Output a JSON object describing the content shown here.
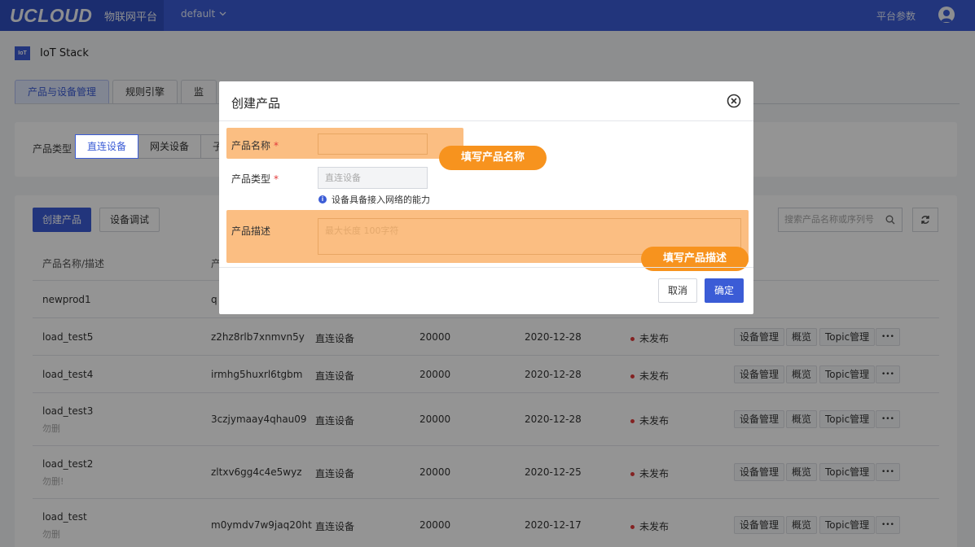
{
  "topbar": {
    "logo": "UCLOUD",
    "platform": "物联网平台",
    "project": "default",
    "platform_params": "平台参数"
  },
  "header": {
    "logo_text": "IoT",
    "title": "IoT Stack"
  },
  "tabs": [
    {
      "label": "产品与设备管理"
    },
    {
      "label": "规则引擎"
    },
    {
      "label": "监"
    }
  ],
  "filter": {
    "label": "产品类型",
    "options": [
      {
        "label": "直连设备"
      },
      {
        "label": "网关设备"
      },
      {
        "label": "子"
      }
    ]
  },
  "toolbar": {
    "create_label": "创建产品",
    "debug_label": "设备调试",
    "search_placeholder": "搜索产品名称或序列号"
  },
  "table": {
    "columns": [
      "产品名称/描述",
      "产"
    ],
    "rows": [
      {
        "name": "newprod1",
        "desc": "",
        "sn": "q",
        "type": "",
        "limit": "",
        "date": "",
        "status": ""
      },
      {
        "name": "load_test5",
        "desc": "",
        "sn": "z2hz8rlb7xnmvn5y",
        "type": "直连设备",
        "limit": "20000",
        "date": "2020-12-28",
        "status": "未发布"
      },
      {
        "name": "load_test4",
        "desc": "",
        "sn": "irmhg5huxrl6tgbm",
        "type": "直连设备",
        "limit": "20000",
        "date": "2020-12-28",
        "status": "未发布"
      },
      {
        "name": "load_test3",
        "desc": "勿删",
        "sn": "3czjymaay4qhau09",
        "type": "直连设备",
        "limit": "20000",
        "date": "2020-12-28",
        "status": "未发布"
      },
      {
        "name": "load_test2",
        "desc": "勿删!",
        "sn": "zltxv6gg4c4e5wyz",
        "type": "直连设备",
        "limit": "20000",
        "date": "2020-12-25",
        "status": "未发布"
      },
      {
        "name": "load_test",
        "desc": "勿删",
        "sn": "m0ymdv7w9jaq20ht",
        "type": "直连设备",
        "limit": "20000",
        "date": "2020-12-17",
        "status": "未发布"
      }
    ],
    "ops": {
      "manage": "设备管理",
      "overview": "概览",
      "topic": "Topic管理",
      "more": "•••"
    }
  },
  "modal": {
    "title": "创建产品",
    "name_label": "产品名称",
    "required_mark": "*",
    "type_label": "产品类型",
    "type_value": "直连设备",
    "hint": "设备具备接入网络的能力",
    "desc_label": "产品描述",
    "desc_placeholder": "最大长度 100字符",
    "cancel": "取消",
    "ok": "确定",
    "callout_name": "填写产品名称",
    "callout_desc": "填写产品描述"
  },
  "colors": {
    "primary": "#3b5cd6",
    "highlight": "#fbbe82",
    "callout": "#f7931e",
    "status_unpublished": "#e23b3b"
  }
}
